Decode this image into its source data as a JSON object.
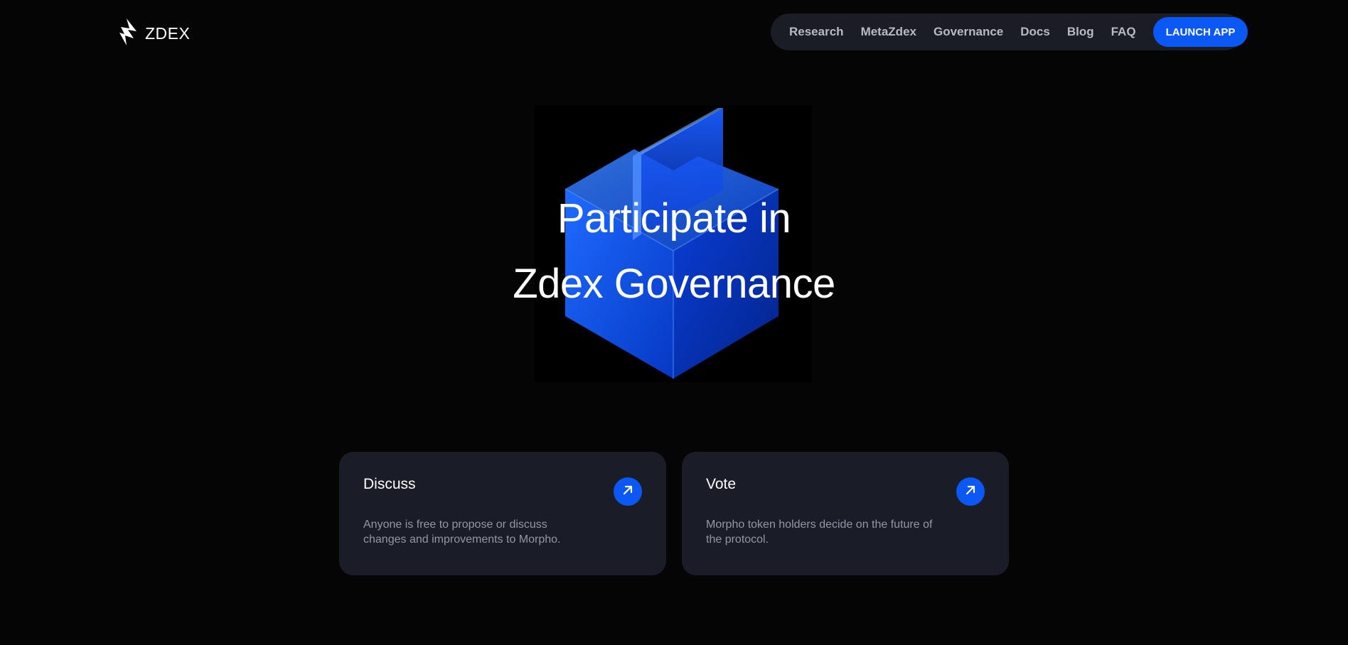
{
  "brand": {
    "name": "ZDEX",
    "logo_icon": "lightning-bolt-icon"
  },
  "nav": {
    "links": [
      "Research",
      "MetaZdex",
      "Governance",
      "Docs",
      "Blog",
      "FAQ"
    ],
    "cta_label": "LAUNCH APP"
  },
  "hero": {
    "line1": "Participate in",
    "line2": "Zdex Governance",
    "art": "blue-glass-cube"
  },
  "cards": [
    {
      "title": "Discuss",
      "description": "Anyone is free to propose or discuss changes and improvements to Morpho.",
      "icon": "arrow-up-right-icon"
    },
    {
      "title": "Vote",
      "description": "Morpho token holders decide on the future of the protocol.",
      "icon": "arrow-up-right-icon"
    }
  ],
  "colors": {
    "accent": "#0b58f5",
    "background": "#050505",
    "card": "#1a1d28",
    "nav_bg": "#1a1d26",
    "muted_text": "#9397a5"
  }
}
